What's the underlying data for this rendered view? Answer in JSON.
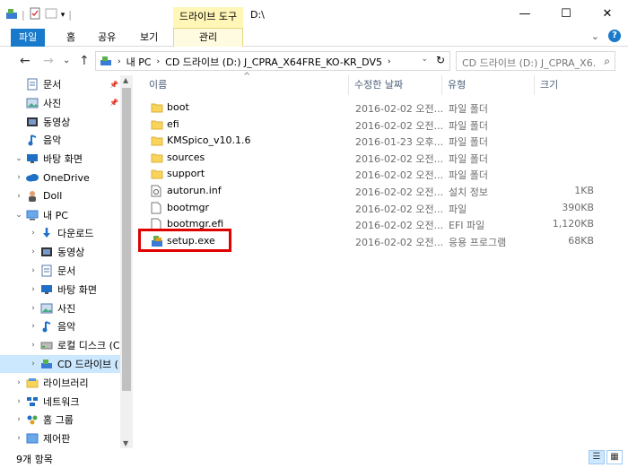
{
  "window": {
    "title": "D:\\",
    "context_tab": "드라이브 도구",
    "minimize": "—",
    "maximize": "☐",
    "close": "✕"
  },
  "ribbon": {
    "tabs": [
      "파일",
      "홈",
      "공유",
      "보기"
    ],
    "context_tab": "관리"
  },
  "nav": {
    "back": "←",
    "forward": "→",
    "recent": "⌄",
    "up": "↑",
    "breadcrumb": [
      "내 PC",
      "CD 드라이브 (D:) J_CPRA_X64FRE_KO-KR_DV5"
    ],
    "search_placeholder": "CD 드라이브 (D:) J_CPRA_X6..."
  },
  "sidebar": {
    "items": [
      {
        "label": "문서",
        "icon": "documents-icon",
        "pinned": true
      },
      {
        "label": "사진",
        "icon": "pictures-icon",
        "pinned": true
      },
      {
        "label": "동영상",
        "icon": "videos-icon"
      },
      {
        "label": "음악",
        "icon": "music-icon"
      },
      {
        "label": "바탕 화면",
        "icon": "desktop-icon",
        "expanded": true
      },
      {
        "label": "OneDrive",
        "icon": "onedrive-icon"
      },
      {
        "label": "Doll",
        "icon": "user-icon"
      },
      {
        "label": "내 PC",
        "icon": "pc-icon",
        "expanded": true
      },
      {
        "label": "다운로드",
        "icon": "downloads-icon"
      },
      {
        "label": "동영상",
        "icon": "videos-icon"
      },
      {
        "label": "문서",
        "icon": "documents-icon"
      },
      {
        "label": "바탕 화면",
        "icon": "desktop-icon"
      },
      {
        "label": "사진",
        "icon": "pictures-icon"
      },
      {
        "label": "음악",
        "icon": "music-icon"
      },
      {
        "label": "로컬 디스크 (C",
        "icon": "disk-icon"
      },
      {
        "label": "CD 드라이브 (",
        "icon": "cd-drive-icon",
        "selected": true
      },
      {
        "label": "라이브러리",
        "icon": "library-icon"
      },
      {
        "label": "네트워크",
        "icon": "network-icon"
      },
      {
        "label": "홈 그룹",
        "icon": "homegroup-icon"
      },
      {
        "label": "제어판",
        "icon": "control-panel-icon"
      }
    ]
  },
  "columns": {
    "name": "이름",
    "date": "수정한 날짜",
    "type": "유형",
    "size": "크기"
  },
  "files": [
    {
      "name": "boot",
      "date": "2016-02-02 오전...",
      "type": "파일 폴더",
      "size": "",
      "icon": "folder-icon"
    },
    {
      "name": "efi",
      "date": "2016-02-02 오전...",
      "type": "파일 폴더",
      "size": "",
      "icon": "folder-icon"
    },
    {
      "name": "KMSpico_v10.1.6",
      "date": "2016-01-23 오후...",
      "type": "파일 폴더",
      "size": "",
      "icon": "folder-icon"
    },
    {
      "name": "sources",
      "date": "2016-02-02 오전...",
      "type": "파일 폴더",
      "size": "",
      "icon": "folder-icon"
    },
    {
      "name": "support",
      "date": "2016-02-02 오전...",
      "type": "파일 폴더",
      "size": "",
      "icon": "folder-icon"
    },
    {
      "name": "autorun.inf",
      "date": "2016-02-02 오전...",
      "type": "설치 정보",
      "size": "1KB",
      "icon": "settings-file-icon"
    },
    {
      "name": "bootmgr",
      "date": "2016-02-02 오전...",
      "type": "파일",
      "size": "390KB",
      "icon": "file-icon"
    },
    {
      "name": "bootmgr.efi",
      "date": "2016-02-02 오전...",
      "type": "EFI 파일",
      "size": "1,120KB",
      "icon": "file-icon"
    },
    {
      "name": "setup.exe",
      "date": "2016-02-02 오전...",
      "type": "응용 프로그램",
      "size": "68KB",
      "icon": "setup-exe-icon"
    }
  ],
  "status": {
    "count": "9개 항목"
  },
  "colors": {
    "accent": "#1979ca",
    "selection": "#cce8ff",
    "highlight_box": "#e00000",
    "context_tab": "#fff6b8"
  }
}
